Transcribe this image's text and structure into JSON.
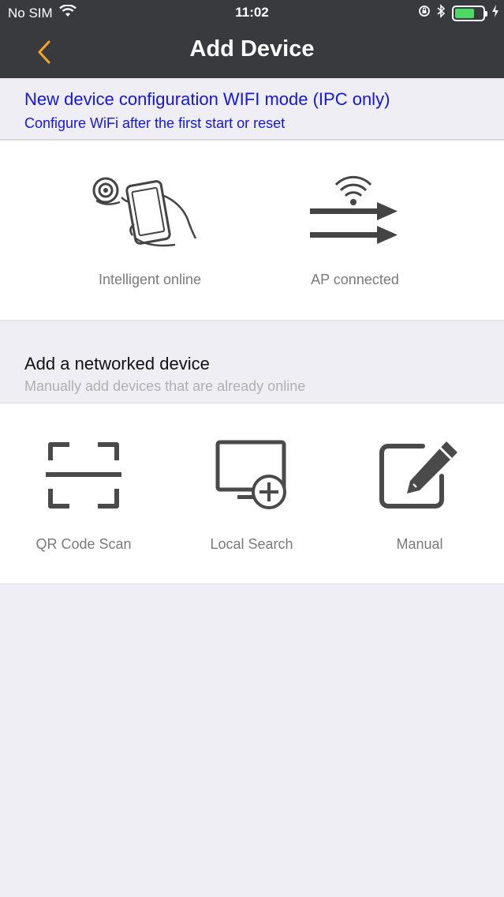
{
  "status_bar": {
    "carrier": "No SIM",
    "time": "11:02",
    "battery_level": 0.7
  },
  "nav": {
    "title": "Add Device"
  },
  "wifi_section": {
    "title": "New device configuration WIFI mode (IPC only)",
    "subtitle": "Configure WiFi after the first start or reset"
  },
  "wifi_options": [
    {
      "label": "Intelligent online",
      "icon": "phone-camera-hand-icon"
    },
    {
      "label": "AP connected",
      "icon": "wifi-arrows-icon"
    }
  ],
  "network_section": {
    "title": "Add a networked device",
    "subtitle": "Manually add devices that are already online"
  },
  "network_options": [
    {
      "label": "QR Code Scan",
      "icon": "qr-scan-icon"
    },
    {
      "label": "Local Search",
      "icon": "monitor-plus-icon"
    },
    {
      "label": "Manual",
      "icon": "edit-pencil-icon"
    }
  ],
  "colors": {
    "header_bg": "#383a3e",
    "accent_back": "#f5a623",
    "wifi_text": "#1515e6",
    "icon_gray": "#4a4a4a"
  }
}
